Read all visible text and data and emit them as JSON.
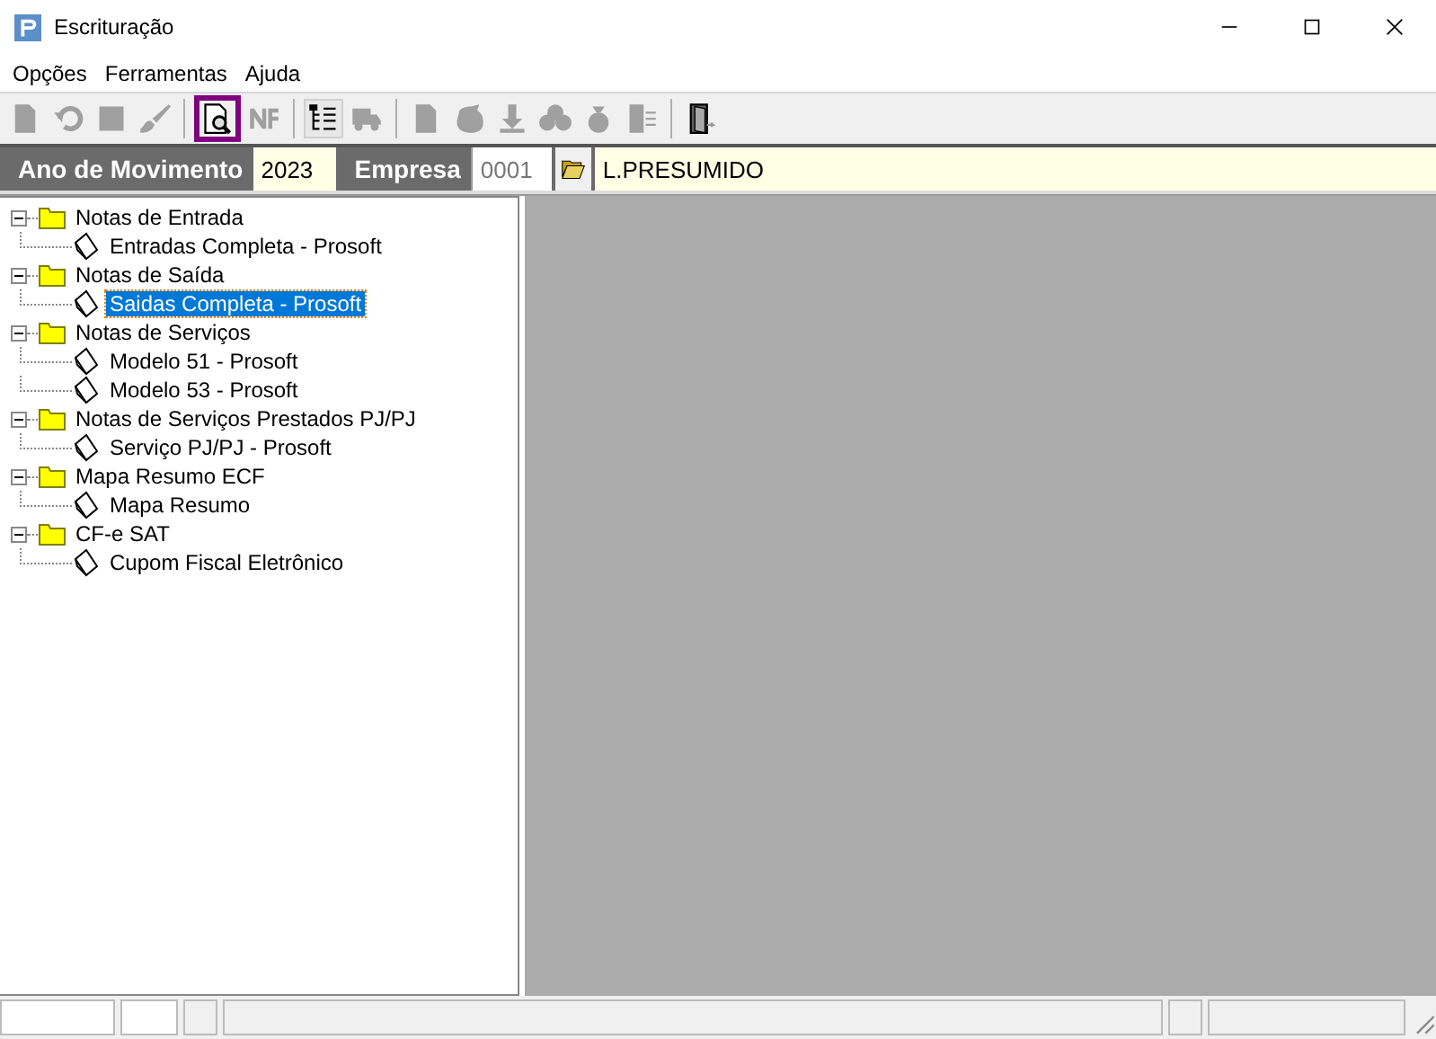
{
  "window": {
    "title": "Escrituração"
  },
  "menu": [
    "Opções",
    "Ferramentas",
    "Ajuda"
  ],
  "toolbar": [
    {
      "kind": "page",
      "disabled": true,
      "selected": false
    },
    {
      "kind": "undo",
      "disabled": true,
      "selected": false
    },
    {
      "kind": "square",
      "disabled": true,
      "selected": false
    },
    {
      "kind": "brush",
      "disabled": true,
      "selected": false
    },
    {
      "kind": "separator"
    },
    {
      "kind": "preview",
      "disabled": false,
      "selected": true
    },
    {
      "kind": "nfe",
      "disabled": true,
      "selected": false
    },
    {
      "kind": "separator"
    },
    {
      "kind": "tree",
      "disabled": false,
      "selected": false,
      "pressed": true
    },
    {
      "kind": "truck",
      "disabled": true,
      "selected": false
    },
    {
      "kind": "separator"
    },
    {
      "kind": "page",
      "disabled": true,
      "selected": false
    },
    {
      "kind": "blob",
      "disabled": true,
      "selected": false
    },
    {
      "kind": "download",
      "disabled": true,
      "selected": false
    },
    {
      "kind": "clover",
      "disabled": true,
      "selected": false
    },
    {
      "kind": "bag",
      "disabled": true,
      "selected": false
    },
    {
      "kind": "listdoc",
      "disabled": true,
      "selected": false
    },
    {
      "kind": "separator"
    },
    {
      "kind": "door",
      "disabled": false,
      "selected": false
    }
  ],
  "filter_bar": {
    "year_label": "Ano de Movimento",
    "year": "2023",
    "company_label": "Empresa",
    "company_code": "0001",
    "company_name": "L.PRESUMIDO"
  },
  "tree": [
    {
      "label": "Notas de Entrada",
      "expanded": true,
      "selected": false,
      "children": [
        {
          "label": "Entradas Completa - Prosoft",
          "selected": false
        }
      ]
    },
    {
      "label": "Notas de Saída",
      "expanded": true,
      "selected": false,
      "children": [
        {
          "label": "Saidas Completa - Prosoft",
          "selected": true
        }
      ]
    },
    {
      "label": "Notas de Serviços",
      "expanded": true,
      "selected": false,
      "children": [
        {
          "label": "Modelo 51 - Prosoft",
          "selected": false
        },
        {
          "label": "Modelo 53 - Prosoft",
          "selected": false
        }
      ]
    },
    {
      "label": "Notas de Serviços Prestados PJ/PJ",
      "expanded": true,
      "selected": false,
      "children": [
        {
          "label": "Serviço PJ/PJ - Prosoft",
          "selected": false
        }
      ]
    },
    {
      "label": "Mapa Resumo ECF",
      "expanded": true,
      "selected": false,
      "children": [
        {
          "label": "Mapa Resumo",
          "selected": false
        }
      ]
    },
    {
      "label": "CF-e SAT",
      "expanded": true,
      "selected": false,
      "children": [
        {
          "label": "Cupom Fiscal Eletrônico",
          "selected": false
        }
      ]
    }
  ]
}
